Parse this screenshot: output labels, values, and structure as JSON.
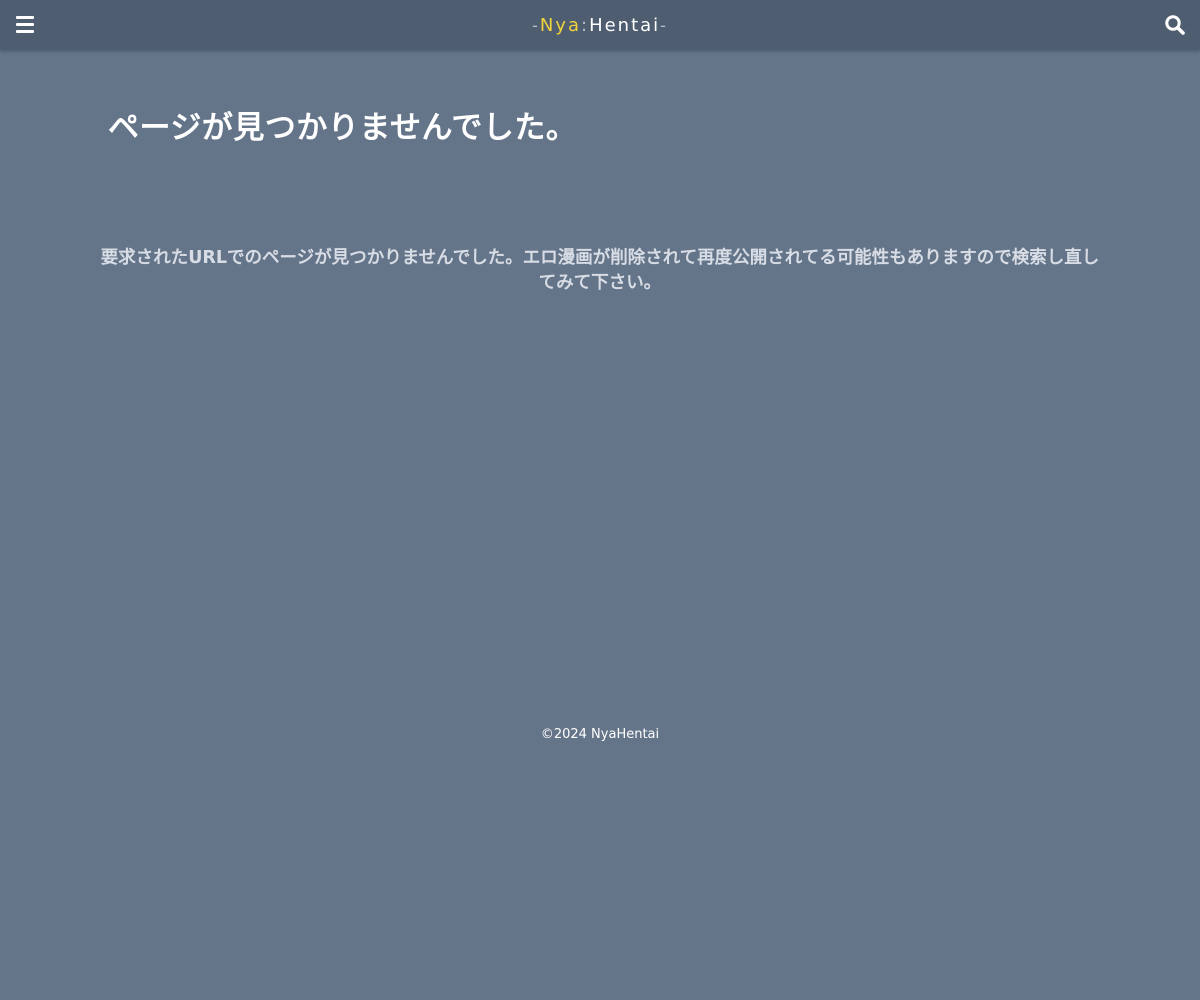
{
  "header": {
    "menu_icon": "hamburger-menu-icon",
    "logo": {
      "dash_left": "-",
      "nya": "Nya",
      "colon": ":",
      "hentai": "Hentai",
      "dash_right": "-"
    },
    "search_icon": "search-icon"
  },
  "main": {
    "title": "ページが見つかりませんでした。",
    "message": "要求されたURLでのページが見つかりませんでした。エロ漫画が削除されて再度公開されてる可能性もありますので検索し直してみて下さい。"
  },
  "footer": {
    "copyright": "©2024 NyaHentai"
  },
  "colors": {
    "background": "#647489",
    "header": "#4f5d70",
    "logo_accent": "#f0d23a",
    "text_primary": "#ffffff",
    "text_secondary": "#d8dde5"
  }
}
